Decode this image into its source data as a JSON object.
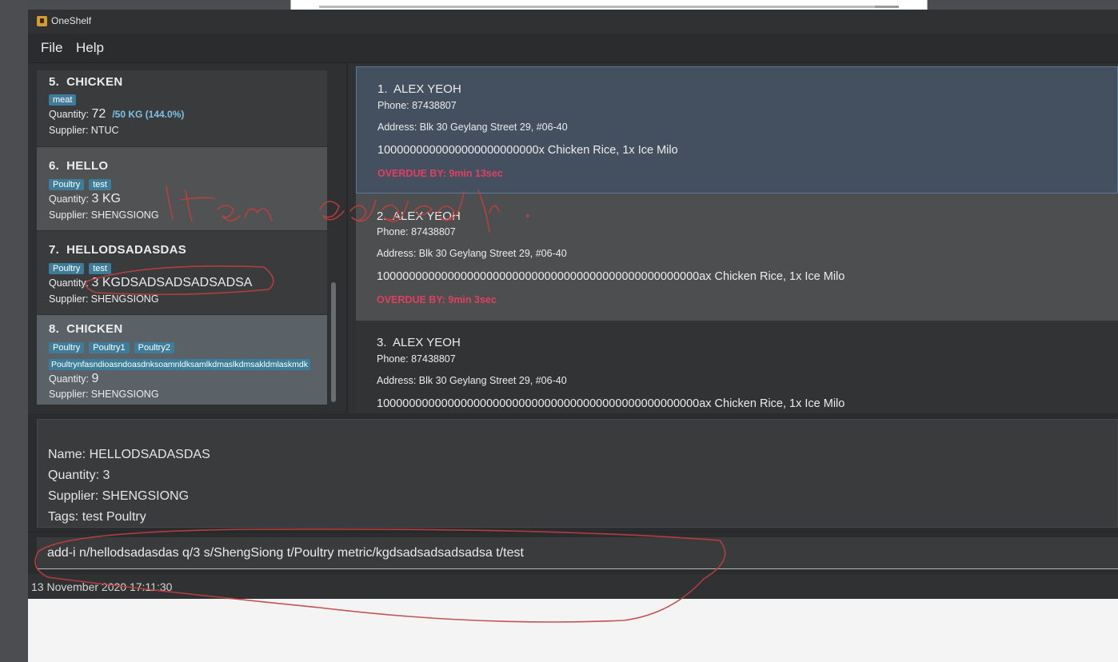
{
  "window": {
    "title": "OneShelf"
  },
  "menu": [
    {
      "label": "File"
    },
    {
      "label": "Help"
    }
  ],
  "items": [
    {
      "index": "5.",
      "name": "CHICKEN",
      "tags": [
        "meat"
      ],
      "quantity_label": "Quantity:",
      "quantity": "72",
      "quantity_extra": "/50 KG (144.0%)",
      "supplier": "Supplier: NTUC"
    },
    {
      "index": "6.",
      "name": "HELLO",
      "tags": [
        "Poultry",
        "test"
      ],
      "quantity_label": "Quantity:",
      "quantity": "3 KG",
      "supplier": "Supplier: SHENGSIONG"
    },
    {
      "index": "7.",
      "name": "HELLODSADASDAS",
      "tags": [
        "Poultry",
        "test"
      ],
      "quantity_label": "Quantity:",
      "quantity": "3 KGDSADSADSADSADSA",
      "supplier": "Supplier: SHENGSIONG"
    },
    {
      "index": "8.",
      "name": "CHICKEN",
      "tags": [
        "Poultry",
        "Poultry1",
        "Poultry2"
      ],
      "long_tag": "Poultrynfasndioasndoasdnksoamnldksamlkdmaslkdmsakldmlaskmdk",
      "quantity_label": "Quantity:",
      "quantity": "9",
      "supplier": "Supplier: SHENGSIONG"
    }
  ],
  "deliveries": [
    {
      "index": "1.",
      "name": "ALEX YEOH",
      "phone": "Phone: 87438807",
      "address": "Address: Blk 30 Geylang Street 29, #06-40",
      "order": "1000000000000000000000000x Chicken Rice, 1x Ice Milo",
      "overdue": "OVERDUE BY: 9min 13sec"
    },
    {
      "index": "2.",
      "name": "ALEX YEOH",
      "phone": "Phone: 87438807",
      "address": "Address: Blk 30 Geylang Street 29, #06-40",
      "order": "10000000000000000000000000000000000000000000000000ax Chicken Rice, 1x Ice Milo",
      "overdue": "OVERDUE BY: 9min 3sec"
    },
    {
      "index": "3.",
      "name": "ALEX YEOH",
      "phone": "Phone: 87438807",
      "address": "Address: Blk 30 Geylang Street 29, #06-40",
      "order": "10000000000000000000000000000000000000000000000000ax Chicken Rice, 1x Ice Milo"
    }
  ],
  "result": {
    "name": "Name: HELLODSADASDAS",
    "quantity": "Quantity: 3",
    "supplier": "Supplier: SHENGSIONG",
    "tags": "Tags: test Poultry"
  },
  "command": {
    "value": "add-i n/hellodsadasdas q/3 s/ShengSiong t/Poultry metric/kgdsadsadsadsadsa t/test"
  },
  "status": {
    "datetime": "13 November 2020 17:11:30"
  },
  "annotation": {
    "text": "Item added",
    "color": "#c0403f"
  }
}
